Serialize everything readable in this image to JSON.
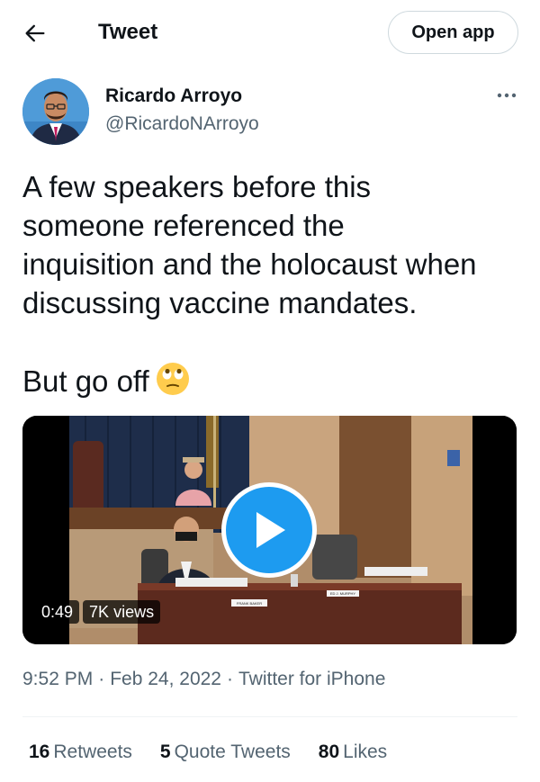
{
  "header": {
    "title": "Tweet",
    "back_icon": "arrow-left-icon",
    "open_app_label": "Open app"
  },
  "author": {
    "name": "Ricardo Arroyo",
    "handle": "@RicardoNArroyo",
    "more_icon": "more-horizontal-icon"
  },
  "tweet": {
    "paragraph_1": "A few speakers before this\nsomeone referenced the\ninquisition and the holocaust when\ndiscussing vaccine mandates.",
    "paragraph_2": "But go off",
    "emoji": "face-with-rolling-eyes-emoji"
  },
  "video": {
    "duration": "0:49",
    "views": "7K views",
    "play_icon": "play-icon",
    "nameplate_left": "FRANK BAKER",
    "nameplate_right": "ED J. MURPHY"
  },
  "meta": {
    "time": "9:52 PM",
    "separator": "·",
    "date": "Feb 24, 2022",
    "source": "Twitter for iPhone"
  },
  "stats": {
    "retweets_count": "16",
    "retweets_label": "Retweets",
    "quotes_count": "5",
    "quotes_label": "Quote Tweets",
    "likes_count": "80",
    "likes_label": "Likes"
  },
  "colors": {
    "accent": "#1d9bf0",
    "text": "#0f1419",
    "secondary_text": "#536471"
  }
}
